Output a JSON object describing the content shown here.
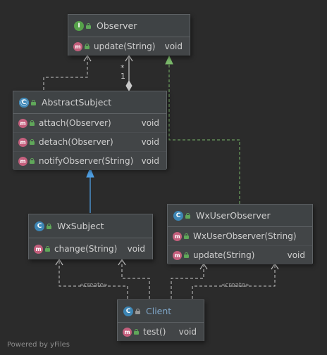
{
  "observer": {
    "title": "Observer",
    "badge": "I",
    "methods": [
      {
        "name": "update(String)",
        "ret": "void"
      }
    ]
  },
  "abstract_subject": {
    "title": "AbstractSubject",
    "badge": "C",
    "methods": [
      {
        "name": "attach(Observer)",
        "ret": "void"
      },
      {
        "name": "detach(Observer)",
        "ret": "void"
      },
      {
        "name": "notifyObserver(String)",
        "ret": "void"
      }
    ]
  },
  "wx_subject": {
    "title": "WxSubject",
    "badge": "C",
    "methods": [
      {
        "name": "change(String)",
        "ret": "void"
      }
    ]
  },
  "wx_user_observer": {
    "title": "WxUserObserver",
    "badge": "C",
    "methods": [
      {
        "name": "WxUserObserver(String)",
        "ret": ""
      },
      {
        "name": "update(String)",
        "ret": "void"
      }
    ]
  },
  "client": {
    "title": "Client",
    "badge": "C",
    "methods": [
      {
        "name": "test()",
        "ret": "void"
      }
    ]
  },
  "method_badge": "m",
  "multiplicity": {
    "many": "*",
    "one": "1"
  },
  "create_label_left": "«create»",
  "create_label_right": "«create»",
  "footer": "Powered by yFiles",
  "colors": {
    "background": "#2b2b2b",
    "interface_badge": "#56a14a",
    "class_badge": "#3d86b5",
    "method_badge": "#c45f7d",
    "inheritance_arrow": "#4e9de0",
    "realization_arrow": "#7ab86a",
    "edge": "#c8c8c8"
  }
}
